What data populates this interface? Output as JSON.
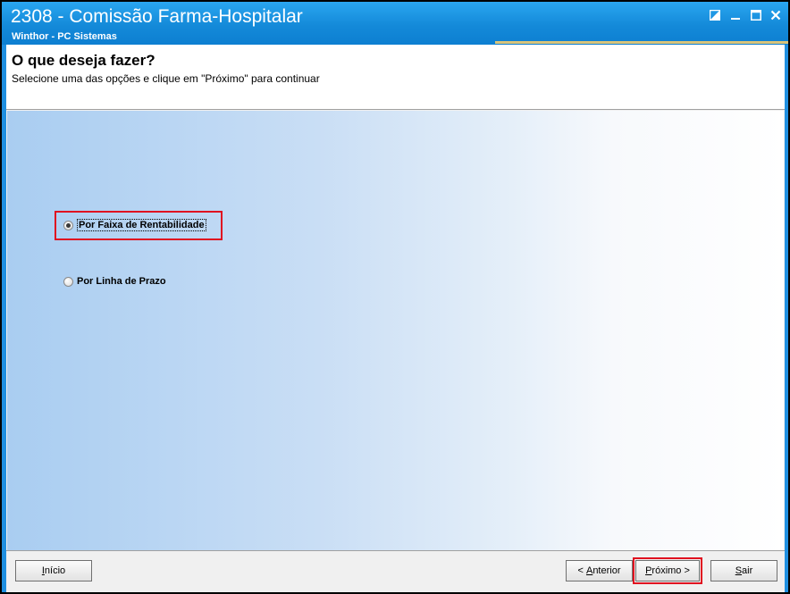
{
  "window": {
    "title": "2308 - Comissão Farma-Hospitalar",
    "subtitle": "Winthor - PC Sistemas",
    "controls": {
      "restore": "◪",
      "minimize": "—",
      "maximize": "☐",
      "close": "✕"
    }
  },
  "header": {
    "title": "O que deseja fazer?",
    "subtitle": "Selecione uma das opções e clique em \"Próximo\" para continuar"
  },
  "options": [
    {
      "label": "Por Faixa de Rentabilidade",
      "checked": true
    },
    {
      "label": "Por Linha de Prazo",
      "checked": false
    }
  ],
  "buttons": {
    "inicio": {
      "accel": "I",
      "rest": "nício"
    },
    "anterior": {
      "prefix": "< ",
      "accel": "A",
      "rest": "nterior"
    },
    "proximo": {
      "accel": "P",
      "rest": "róximo >"
    },
    "sair": {
      "accel": "S",
      "rest": "air"
    }
  },
  "colors": {
    "titlebar": "#148ad9",
    "highlight": "#e01020"
  }
}
